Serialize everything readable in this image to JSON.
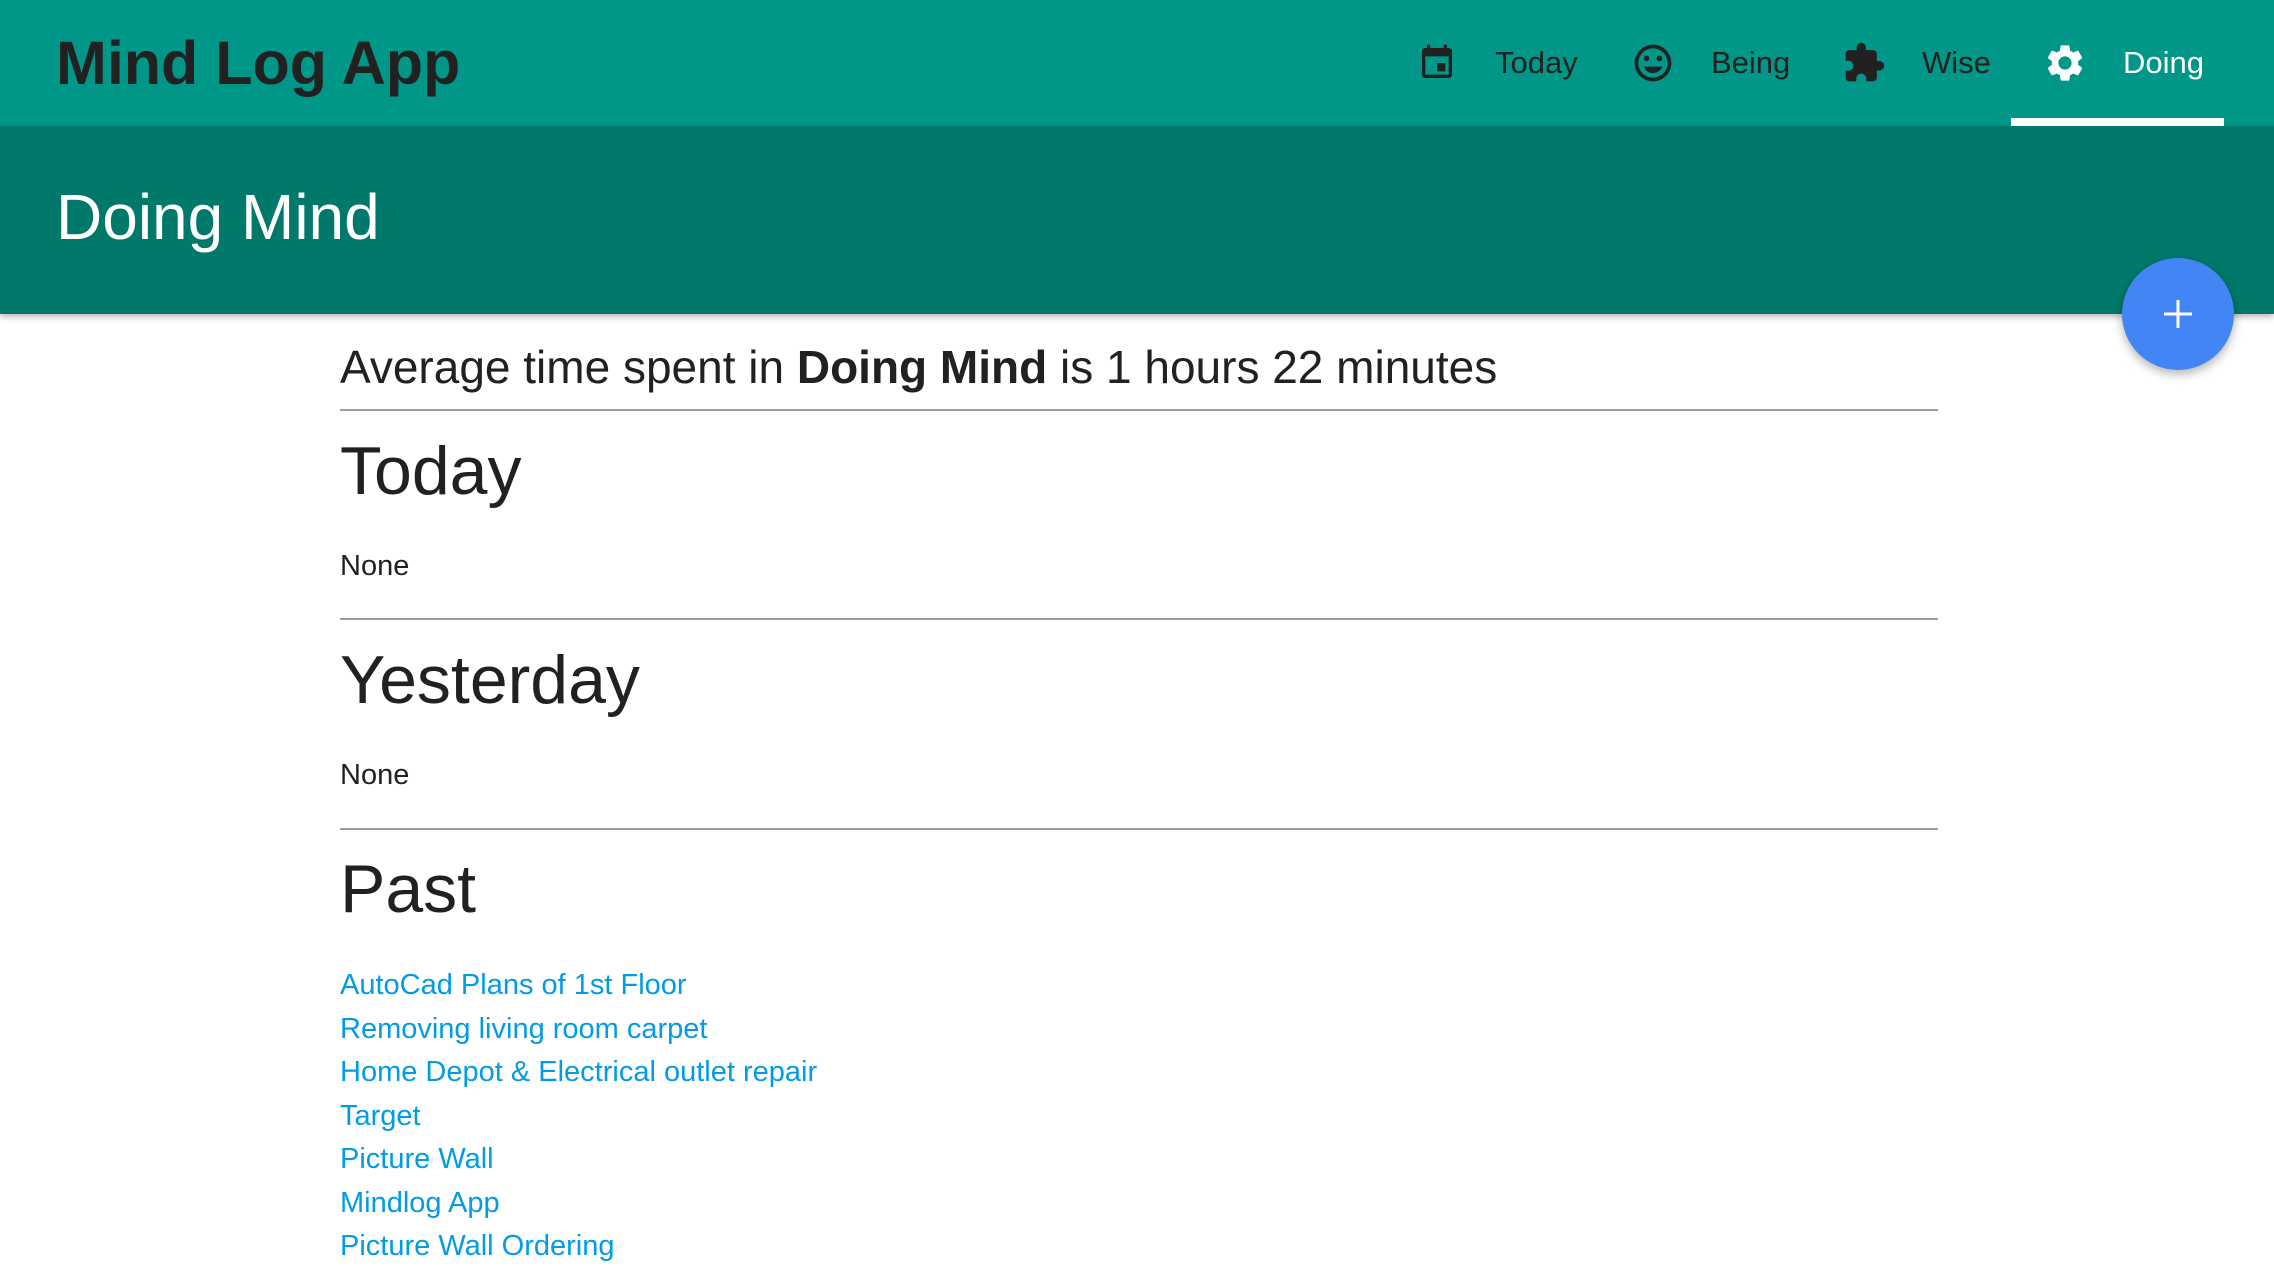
{
  "app": {
    "title": "Mind Log App"
  },
  "nav": {
    "tabs": [
      {
        "label": "Today",
        "icon": "calendar-icon",
        "active": false
      },
      {
        "label": "Being",
        "icon": "smiley-face-icon",
        "active": false
      },
      {
        "label": "Wise",
        "icon": "puzzle-piece-icon",
        "active": false
      },
      {
        "label": "Doing",
        "icon": "gear-icon",
        "active": true
      }
    ]
  },
  "header": {
    "page_title": "Doing Mind"
  },
  "fab": {
    "icon": "plus-icon",
    "symbol": "+"
  },
  "summary": {
    "prefix": "Average time spent in ",
    "mind": "Doing Mind",
    "suffix": " is 1 hours 22 minutes"
  },
  "sections": {
    "today": {
      "heading": "Today",
      "text": "None"
    },
    "yesterday": {
      "heading": "Yesterday",
      "text": "None"
    },
    "past": {
      "heading": "Past",
      "items": [
        "AutoCad Plans of 1st Floor",
        "Removing living room carpet",
        "Home Depot & Electrical outlet repair",
        "Target",
        "Picture Wall",
        "Mindlog App",
        "Picture Wall Ordering"
      ]
    }
  },
  "colors": {
    "top_bar": "#009688",
    "sub_header": "#00796b",
    "fab": "#4285f4",
    "link": "#039be5",
    "active_tab": "#ffffff"
  }
}
